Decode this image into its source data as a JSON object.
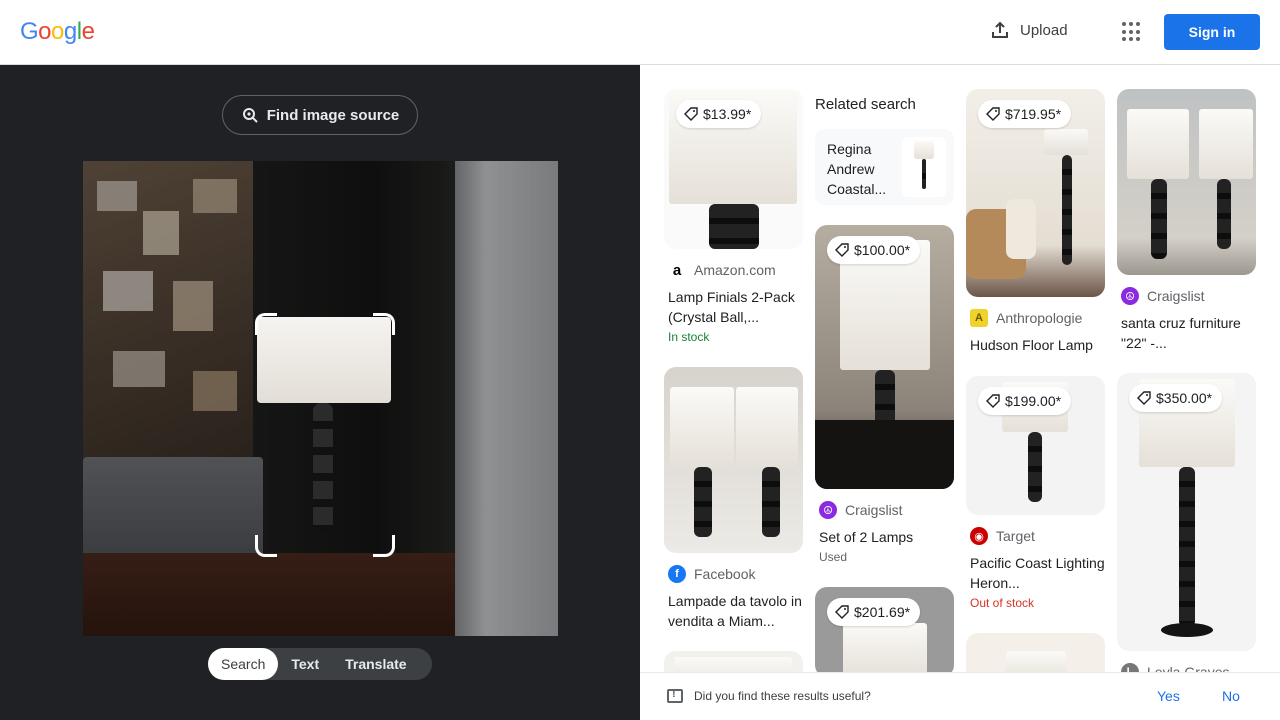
{
  "header": {
    "logo": [
      "G",
      "o",
      "o",
      "g",
      "l",
      "e"
    ],
    "upload_label": "Upload",
    "signin_label": "Sign in"
  },
  "left": {
    "find_source_label": "Find image source",
    "modes": [
      "Search",
      "Text",
      "Translate"
    ],
    "active_mode": "Search"
  },
  "results": {
    "related_heading": "Related search",
    "related_query": "Regina Andrew Coastal...",
    "items": [
      {
        "price": "$13.99*",
        "source": "Amazon.com",
        "title": "Lamp Finials 2-Pack (Crystal Ball,...",
        "status": "In stock"
      },
      {
        "price": "",
        "source": "Facebook",
        "title": "Lampade da tavolo in vendita a Miam...",
        "status": ""
      },
      {
        "price": "$100.00*",
        "source": "Craigslist",
        "title": "Set of 2 Lamps",
        "status": "Used"
      },
      {
        "price": "$201.69*",
        "source": "",
        "title": "",
        "status": ""
      },
      {
        "price": "$719.95*",
        "source": "Anthropologie",
        "title": "Hudson Floor Lamp",
        "status": ""
      },
      {
        "price": "$199.00*",
        "source": "Target",
        "title": "Pacific Coast Lighting Heron...",
        "status": "Out of stock"
      },
      {
        "price": "",
        "source": "Craigslist",
        "title": "santa cruz furniture \"22\" -...",
        "status": ""
      },
      {
        "price": "$350.00*",
        "source": "Leyla Graves",
        "title": "",
        "status": ""
      }
    ]
  },
  "footer": {
    "question": "Did you find these results useful?",
    "yes": "Yes",
    "no": "No"
  }
}
